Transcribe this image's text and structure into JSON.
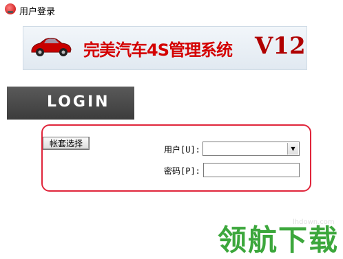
{
  "window": {
    "title": "用户登录"
  },
  "banner": {
    "title": "完美汽车4S管理系统",
    "version": "V12"
  },
  "login": {
    "heading": "LOGIN",
    "account_button": "帐套选择",
    "user_label": "用户[U]:",
    "password_label": "密码[P]:",
    "user_value": "",
    "password_value": ""
  },
  "watermark": {
    "url": "lhdown.com",
    "text": "领航下载"
  },
  "colors": {
    "banner_title": "#d40000",
    "login_bar": "#4a4a4a",
    "highlight_frame": "#e0243a",
    "watermark": "#2ca02c"
  },
  "icons": {
    "app": "car-logo-icon",
    "dropdown": "chevron-down-icon"
  }
}
